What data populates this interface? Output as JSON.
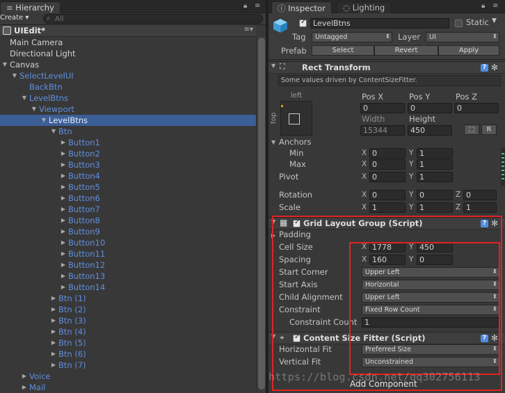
{
  "hierarchy": {
    "tab_label": "Hierarchy",
    "create_label": "Create ▾",
    "search_placeholder": "All",
    "scene_name": "UIEdit*",
    "rows": [
      {
        "label": "Main Camera",
        "depth": 0,
        "arrow": "",
        "style": "white"
      },
      {
        "label": "Directional Light",
        "depth": 0,
        "arrow": "",
        "style": "white"
      },
      {
        "label": "Canvas",
        "depth": 0,
        "arrow": "down",
        "style": "white"
      },
      {
        "label": "SelectLevelUI",
        "depth": 1,
        "arrow": "down",
        "style": "blue"
      },
      {
        "label": "BackBtn",
        "depth": 2,
        "arrow": "",
        "style": "blue"
      },
      {
        "label": "LevelBtns",
        "depth": 2,
        "arrow": "down",
        "style": "blue"
      },
      {
        "label": "Viewport",
        "depth": 3,
        "arrow": "down",
        "style": "blue"
      },
      {
        "label": "LevelBtns",
        "depth": 4,
        "arrow": "down",
        "style": "blue",
        "selected": true
      },
      {
        "label": "Btn",
        "depth": 5,
        "arrow": "down",
        "style": "blue"
      },
      {
        "label": "Button1",
        "depth": 6,
        "arrow": "right",
        "style": "blue"
      },
      {
        "label": "Button2",
        "depth": 6,
        "arrow": "right",
        "style": "blue"
      },
      {
        "label": "Button3",
        "depth": 6,
        "arrow": "right",
        "style": "blue"
      },
      {
        "label": "Button4",
        "depth": 6,
        "arrow": "right",
        "style": "blue"
      },
      {
        "label": "Button5",
        "depth": 6,
        "arrow": "right",
        "style": "blue"
      },
      {
        "label": "Button6",
        "depth": 6,
        "arrow": "right",
        "style": "blue"
      },
      {
        "label": "Button7",
        "depth": 6,
        "arrow": "right",
        "style": "blue"
      },
      {
        "label": "Button8",
        "depth": 6,
        "arrow": "right",
        "style": "blue"
      },
      {
        "label": "Button9",
        "depth": 6,
        "arrow": "right",
        "style": "blue"
      },
      {
        "label": "Button10",
        "depth": 6,
        "arrow": "right",
        "style": "blue"
      },
      {
        "label": "Button11",
        "depth": 6,
        "arrow": "right",
        "style": "blue"
      },
      {
        "label": "Button12",
        "depth": 6,
        "arrow": "right",
        "style": "blue"
      },
      {
        "label": "Button13",
        "depth": 6,
        "arrow": "right",
        "style": "blue"
      },
      {
        "label": "Button14",
        "depth": 6,
        "arrow": "right",
        "style": "blue"
      },
      {
        "label": "Btn (1)",
        "depth": 5,
        "arrow": "right",
        "style": "blue"
      },
      {
        "label": "Btn (2)",
        "depth": 5,
        "arrow": "right",
        "style": "blue"
      },
      {
        "label": "Btn (3)",
        "depth": 5,
        "arrow": "right",
        "style": "blue"
      },
      {
        "label": "Btn (4)",
        "depth": 5,
        "arrow": "right",
        "style": "blue"
      },
      {
        "label": "Btn (5)",
        "depth": 5,
        "arrow": "right",
        "style": "blue"
      },
      {
        "label": "Btn (6)",
        "depth": 5,
        "arrow": "right",
        "style": "blue"
      },
      {
        "label": "Btn (7)",
        "depth": 5,
        "arrow": "right",
        "style": "blue"
      },
      {
        "label": "Voice",
        "depth": 2,
        "arrow": "right",
        "style": "blue"
      },
      {
        "label": "Mail",
        "depth": 2,
        "arrow": "right",
        "style": "blue"
      }
    ]
  },
  "inspector": {
    "tab_label": "Inspector",
    "lighting_tab_label": "Lighting",
    "object_name": "LevelBtns",
    "static_label": "Static",
    "tag_label": "Tag",
    "tag_value": "Untagged",
    "layer_label": "Layer",
    "layer_value": "UI",
    "prefab_label": "Prefab",
    "prefab_select": "Select",
    "prefab_revert": "Revert",
    "prefab_apply": "Apply",
    "rect_transform": {
      "title": "Rect Transform",
      "hint": "Some values driven by ContentSizeFitter.",
      "left_label": "left",
      "top_label": "top",
      "pos_x_label": "Pos X",
      "pos_y_label": "Pos Y",
      "pos_z_label": "Pos Z",
      "pos_x": "0",
      "pos_y": "0",
      "pos_z": "0",
      "width_label": "Width",
      "height_label": "Height",
      "width": "15344",
      "height": "450",
      "r_button": "R",
      "anchors_label": "Anchors",
      "min_label": "Min",
      "max_label": "Max",
      "anchor_min_x": "0",
      "anchor_min_y": "1",
      "anchor_max_x": "0",
      "anchor_max_y": "1",
      "pivot_label": "Pivot",
      "pivot_x": "0",
      "pivot_y": "1",
      "rotation_label": "Rotation",
      "rot_x": "0",
      "rot_y": "0",
      "rot_z": "0",
      "scale_label": "Scale",
      "scale_x": "1",
      "scale_y": "1",
      "scale_z": "1",
      "x": "X",
      "y": "Y",
      "z": "Z"
    },
    "grid_layout": {
      "title": "Grid Layout Group (Script)",
      "padding_label": "Padding",
      "cell_size_label": "Cell Size",
      "cell_x": "1778",
      "cell_y": "450",
      "spacing_label": "Spacing",
      "spacing_x": "160",
      "spacing_y": "0",
      "start_corner_label": "Start Corner",
      "start_corner": "Upper Left",
      "start_axis_label": "Start Axis",
      "start_axis": "Horizontal",
      "child_alignment_label": "Child Alignment",
      "child_alignment": "Upper Left",
      "constraint_label": "Constraint",
      "constraint": "Fixed Row Count",
      "constraint_count_label": "Constraint Count",
      "constraint_count": "1"
    },
    "content_size_fitter": {
      "title": "Content Size Fitter (Script)",
      "horizontal_fit_label": "Horizontal Fit",
      "horizontal_fit": "Preferred Size",
      "vertical_fit_label": "Vertical Fit",
      "vertical_fit": "Unconstrained"
    },
    "add_component": "Add Component"
  },
  "watermark": "https://blog.csdn.net/qq302756113",
  "colors": {
    "selection": "#3d5f97",
    "prefab_blue": "#5f8fe0",
    "highlight_red": "#e32222"
  }
}
